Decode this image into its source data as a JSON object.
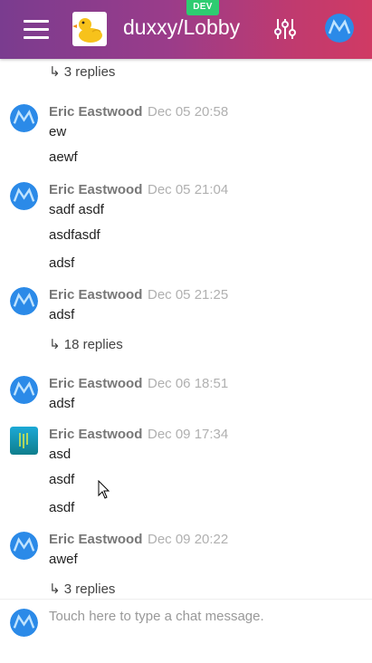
{
  "header": {
    "room_title": "duxxy/Lobby",
    "dev_badge": "DEV",
    "colors": {
      "gradient_start": "#7a3c8f",
      "gradient_end": "#d03a64",
      "dev_badge": "#2ecc71"
    }
  },
  "messages": {
    "top_reply": "↳ 3 replies",
    "groups": [
      {
        "author": "Eric Eastwood",
        "time": "Dec 05 20:58",
        "lines": [
          "ew",
          "aewf"
        ],
        "reply": ""
      },
      {
        "author": "Eric Eastwood",
        "time": "Dec 05 21:04",
        "lines": [
          "sadf asdf",
          "asdfasdf",
          "adsf"
        ],
        "reply": ""
      },
      {
        "author": "Eric Eastwood",
        "time": "Dec 05 21:25",
        "lines": [
          "adsf"
        ],
        "reply": "↳ 18 replies"
      },
      {
        "author": "Eric Eastwood",
        "time": "Dec 06 18:51",
        "lines": [
          "adsf"
        ],
        "reply": ""
      },
      {
        "author": "Eric Eastwood",
        "time": "Dec 09 17:34",
        "lines": [
          "asd",
          "asdf",
          "asdf"
        ],
        "reply": ""
      },
      {
        "author": "Eric Eastwood",
        "time": "Dec 09 20:22",
        "lines": [
          "awef"
        ],
        "reply": "↳ 3 replies"
      }
    ]
  },
  "composer": {
    "placeholder": "Touch here to type a chat message."
  }
}
